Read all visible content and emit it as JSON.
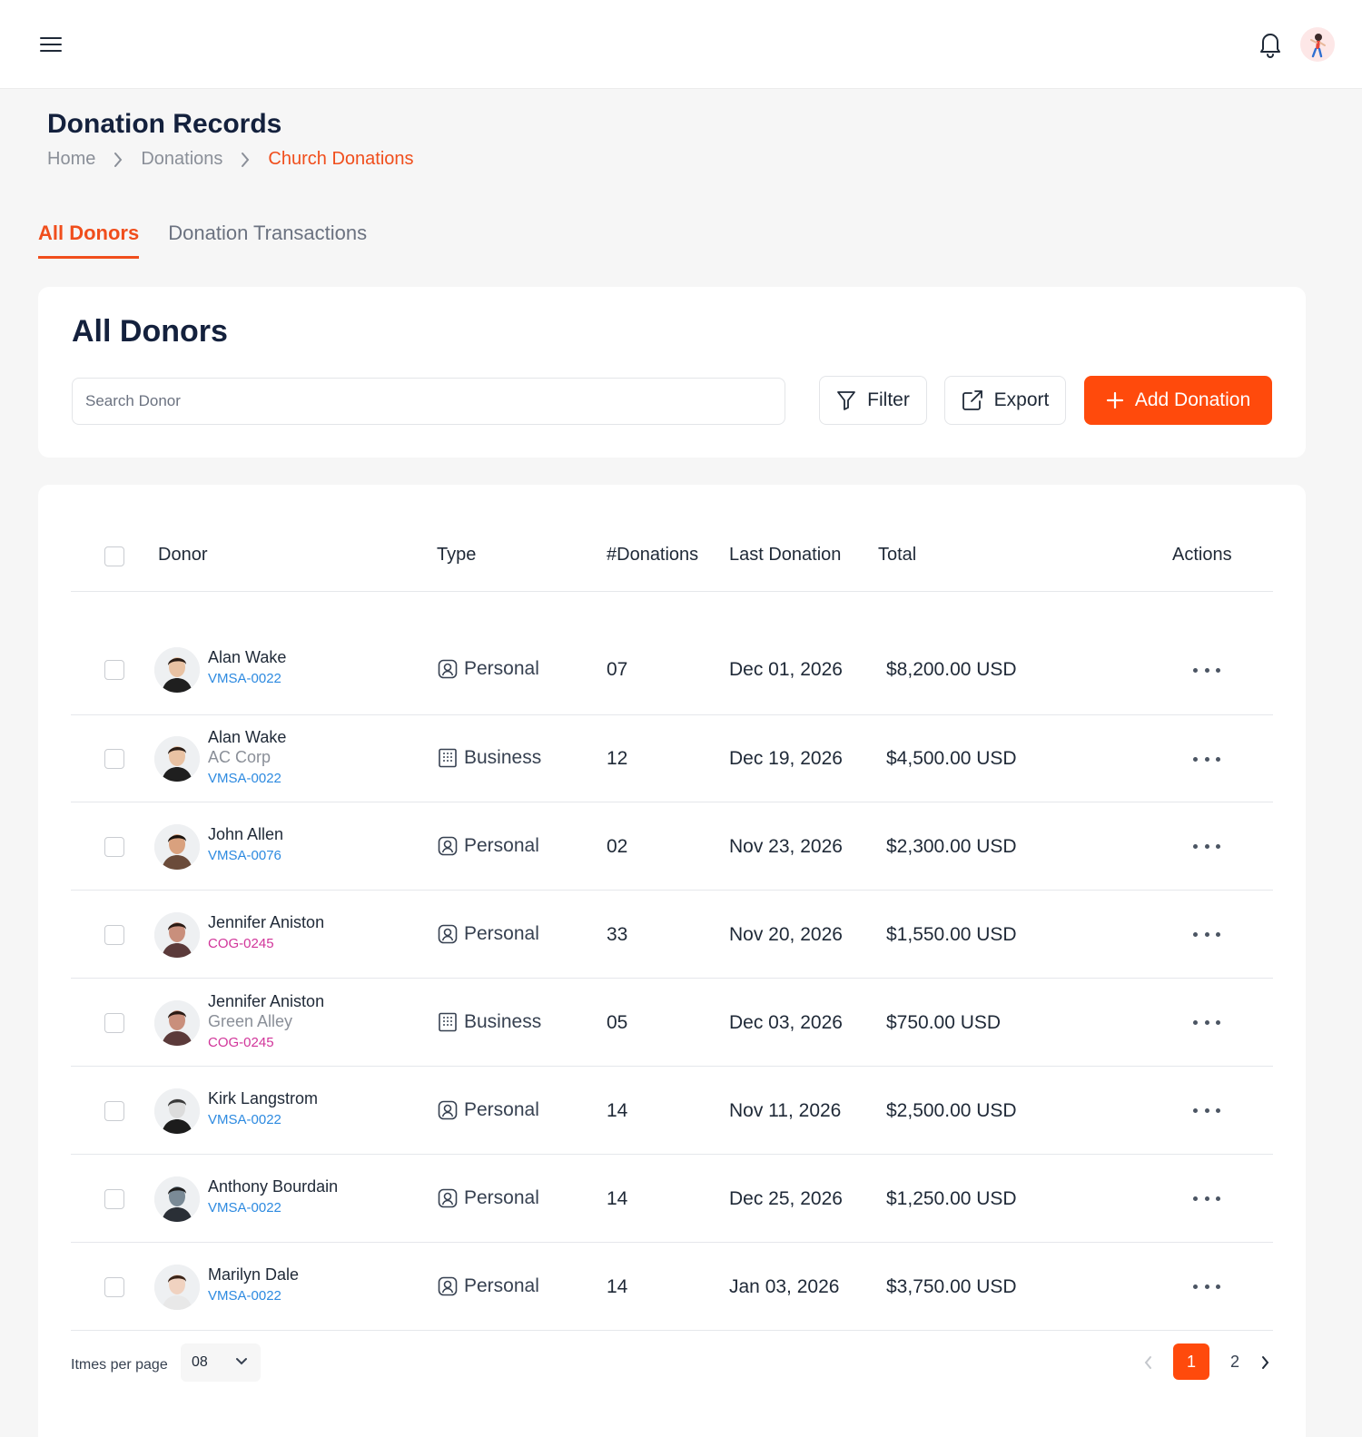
{
  "header": {
    "menu_icon": "hamburger-menu-icon",
    "bell_icon": "bell-icon"
  },
  "page": {
    "title": "Donation Records"
  },
  "breadcrumb": [
    "Home",
    "Donations",
    "Church Donations"
  ],
  "tabs": [
    {
      "label": "All Donors",
      "active": true
    },
    {
      "label": "Donation Transactions",
      "active": false
    }
  ],
  "toolbar": {
    "title": "All Donors",
    "search_placeholder": "Search Donor",
    "filter_label": "Filter",
    "export_label": "Export",
    "add_label": "Add Donation"
  },
  "table": {
    "headers": [
      "Donor",
      "Type",
      "#Donations",
      "Last Donation",
      "Total",
      "Actions"
    ],
    "rows": [
      {
        "name": "Alan Wake",
        "org": "",
        "id": "VMSA-0022",
        "type": "Personal",
        "donations": "07",
        "last": "Dec 01, 2026",
        "total": "$8,200.00 USD"
      },
      {
        "name": "Alan Wake",
        "org": "AC Corp",
        "id": "VMSA-0022",
        "type": "Business",
        "donations": "12",
        "last": "Dec 19, 2026",
        "total": "$4,500.00 USD"
      },
      {
        "name": "John Allen",
        "org": "",
        "id": "VMSA-0076",
        "type": "Personal",
        "donations": "02",
        "last": "Nov 23, 2026",
        "total": "$2,300.00 USD"
      },
      {
        "name": "Jennifer Aniston",
        "org": "",
        "id": "COG-0245",
        "type": "Personal",
        "donations": "33",
        "last": "Nov 20, 2026",
        "total": "$1,550.00 USD"
      },
      {
        "name": "Jennifer Aniston",
        "org": "Green Alley",
        "id": "COG-0245",
        "type": "Business",
        "donations": "05",
        "last": "Dec 03, 2026",
        "total": "$750.00 USD"
      },
      {
        "name": "Kirk Langstrom",
        "org": "",
        "id": "VMSA-0022",
        "type": "Personal",
        "donations": "14",
        "last": "Nov 11, 2026",
        "total": "$2,500.00 USD"
      },
      {
        "name": "Anthony Bourdain",
        "org": "",
        "id": "VMSA-0022",
        "type": "Personal",
        "donations": "14",
        "last": "Dec 25, 2026",
        "total": "$1,250.00 USD"
      },
      {
        "name": "Marilyn Dale",
        "org": "",
        "id": "VMSA-0022",
        "type": "Personal",
        "donations": "14",
        "last": "Jan 03, 2026",
        "total": "$3,750.00 USD"
      }
    ]
  },
  "pagination": {
    "items_per_page_label": "Itmes per page",
    "items_per_page": "08",
    "pages": [
      "1",
      "2"
    ],
    "current": "1"
  },
  "colors": {
    "accent": "#ff4a0c",
    "id_blue": "#2d8ae0",
    "id_magenta": "#d1359a",
    "title": "#14213d"
  }
}
